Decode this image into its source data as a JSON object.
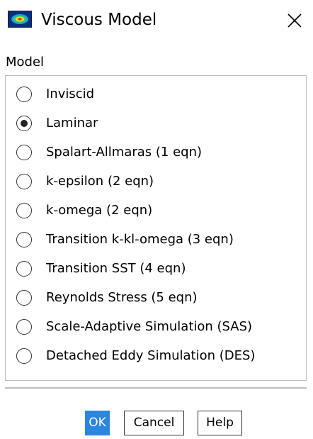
{
  "window": {
    "title": "Viscous Model",
    "icon": "fluent-app-icon",
    "close_icon": "close-icon"
  },
  "model_group": {
    "label": "Model",
    "selected": "Laminar",
    "options": [
      {
        "label": "Inviscid",
        "checked": false
      },
      {
        "label": "Laminar",
        "checked": true
      },
      {
        "label": "Spalart-Allmaras (1 eqn)",
        "checked": false
      },
      {
        "label": "k-epsilon (2 eqn)",
        "checked": false
      },
      {
        "label": "k-omega (2 eqn)",
        "checked": false
      },
      {
        "label": "Transition k-kl-omega (3 eqn)",
        "checked": false
      },
      {
        "label": "Transition SST (4 eqn)",
        "checked": false
      },
      {
        "label": "Reynolds Stress (5 eqn)",
        "checked": false
      },
      {
        "label": "Scale-Adaptive Simulation (SAS)",
        "checked": false
      },
      {
        "label": "Detached Eddy Simulation (DES)",
        "checked": false
      }
    ]
  },
  "buttons": {
    "ok": "OK",
    "cancel": "Cancel",
    "help": "Help"
  },
  "colors": {
    "primary_button": "#2b86e0",
    "border": "#bdbdbd"
  }
}
